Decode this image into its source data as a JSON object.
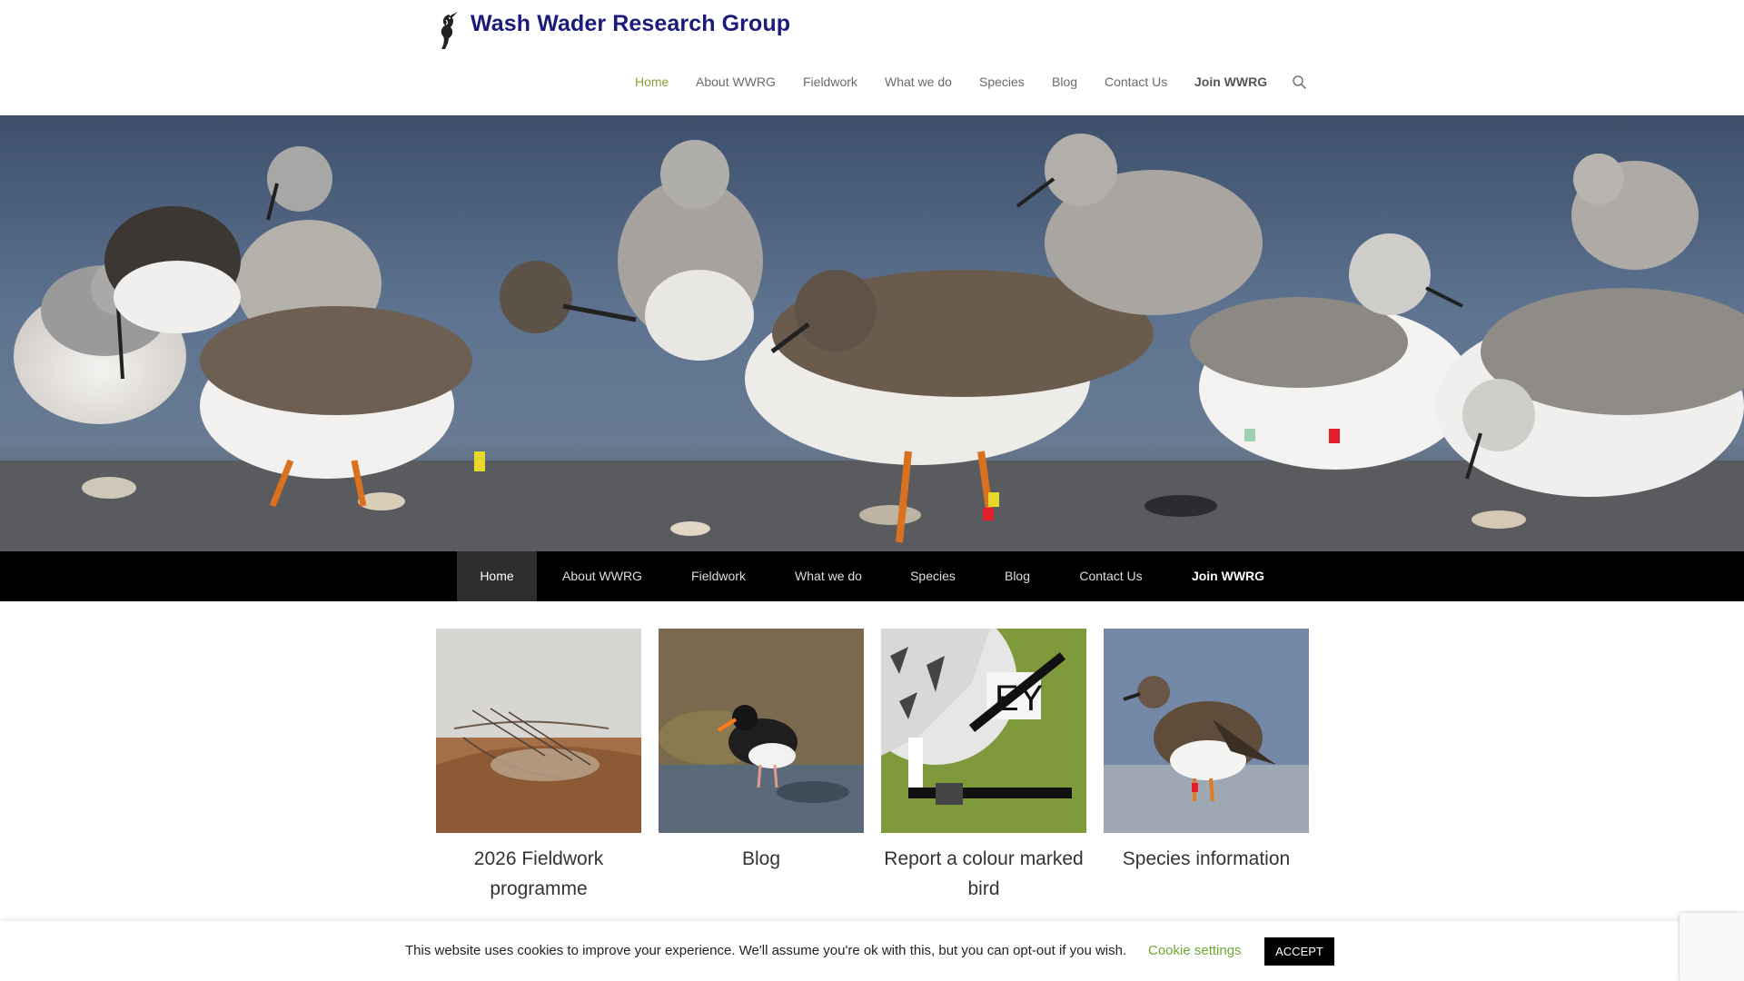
{
  "site": {
    "title": "Wash Wader Research Group",
    "logo_icon": "wader-bird-logo-icon"
  },
  "top_nav": {
    "items": [
      {
        "label": "Home",
        "active": true
      },
      {
        "label": "About WWRG"
      },
      {
        "label": "Fieldwork"
      },
      {
        "label": "What we do"
      },
      {
        "label": "Species"
      },
      {
        "label": "Blog"
      },
      {
        "label": "Contact Us"
      },
      {
        "label": "Join WWRG",
        "bold": true
      }
    ],
    "search_icon": "search-icon"
  },
  "main_nav": {
    "items": [
      {
        "label": "Home",
        "active": true
      },
      {
        "label": "About WWRG"
      },
      {
        "label": "Fieldwork"
      },
      {
        "label": "What we do"
      },
      {
        "label": "Species"
      },
      {
        "label": "Blog"
      },
      {
        "label": "Contact Us"
      },
      {
        "label": "Join WWRG",
        "bold": true
      }
    ]
  },
  "cards": [
    {
      "caption": "2026 Fieldwork programme"
    },
    {
      "caption": "Blog"
    },
    {
      "caption": "Report a colour marked bird"
    },
    {
      "caption": "Species information"
    }
  ],
  "cookie_bar": {
    "message": "This website uses cookies to improve your experience. We'll assume you're ok with this, but you can opt-out if you wish.",
    "settings_label": "Cookie settings",
    "accept_label": "ACCEPT"
  },
  "colors": {
    "title": "#1b1b7a",
    "nav_active": "#8aa03a",
    "main_nav_bg": "#000000",
    "cookie_link": "#6ea832"
  }
}
